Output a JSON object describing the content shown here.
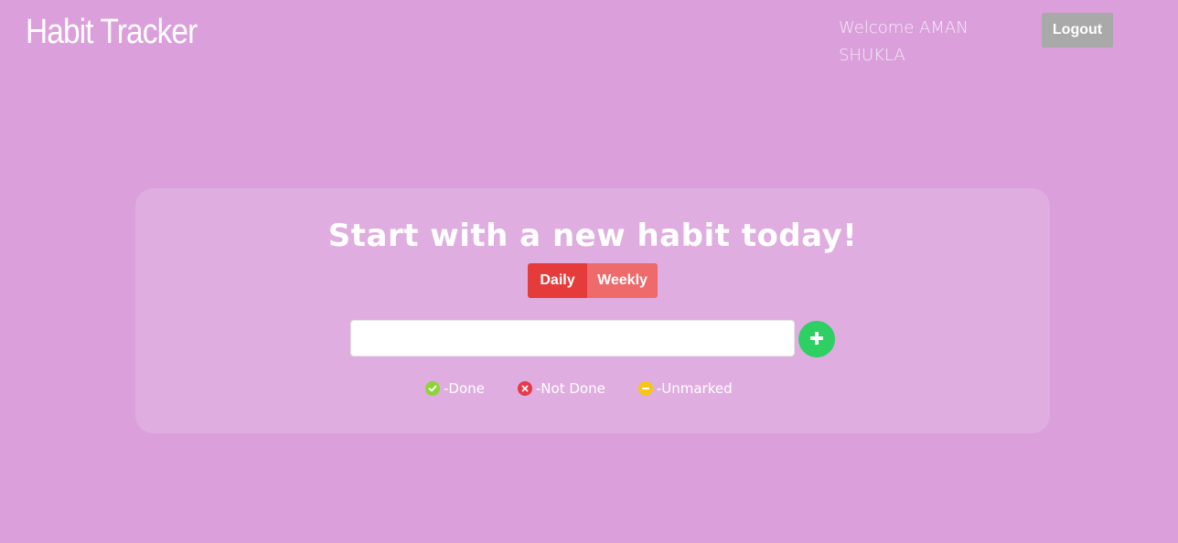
{
  "header": {
    "brand": "Habit Tracker",
    "welcome": "Welcome AMAN SHUKLA",
    "logout_label": "Logout"
  },
  "card": {
    "title": "Start with a new habit today!",
    "tabs": [
      {
        "label": "Daily",
        "active": true
      },
      {
        "label": "Weekly",
        "active": false
      }
    ],
    "input": {
      "value": "",
      "placeholder": ""
    },
    "add_icon": "plus-icon",
    "legend": [
      {
        "icon": "check-circle-icon",
        "label": "-Done",
        "color": "#8cd43a"
      },
      {
        "icon": "x-circle-icon",
        "label": "-Not Done",
        "color": "#e8394a"
      },
      {
        "icon": "minus-circle-icon",
        "label": "-Unmarked",
        "color": "#f5c518"
      }
    ]
  },
  "colors": {
    "background": "#dba0dc",
    "daily_button": "#e63b3b",
    "weekly_button": "#ef6b6b",
    "add_button": "#2ecf63",
    "logout_button": "#a9a9a9"
  }
}
